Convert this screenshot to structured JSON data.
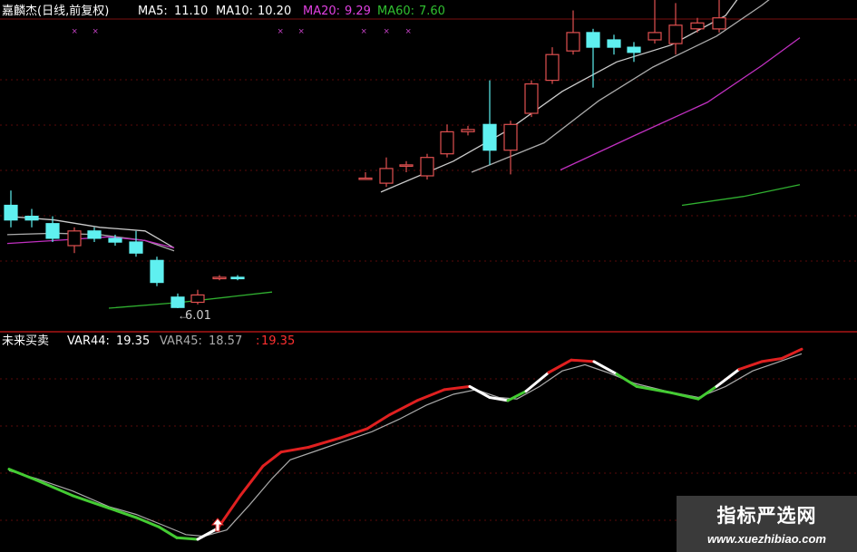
{
  "chart_data": [
    {
      "type": "line",
      "panel": "main",
      "title": "嘉麟杰(日线,前复权)",
      "indicators": [
        {
          "name": "MA5",
          "label": "MA5:",
          "value": "11.10",
          "color": "#ffffff"
        },
        {
          "name": "MA10",
          "label": "MA10:",
          "value": "10.20",
          "color": "#ffffff"
        },
        {
          "name": "MA20",
          "label": "MA20:",
          "value": "9.29",
          "color": "#e040e0"
        },
        {
          "name": "MA60",
          "label": "MA60:",
          "value": "7.60",
          "color": "#30c030"
        }
      ],
      "low_annotation": "6.01",
      "candles": [
        {
          "x": 12,
          "o": 7.4,
          "c": 7.2,
          "h": 7.6,
          "l": 7.1
        },
        {
          "x": 35,
          "o": 7.25,
          "c": 7.2,
          "h": 7.35,
          "l": 7.1
        },
        {
          "x": 58,
          "o": 7.15,
          "c": 6.95,
          "h": 7.25,
          "l": 6.9
        },
        {
          "x": 82,
          "o": 6.85,
          "c": 7.05,
          "h": 7.1,
          "l": 6.75
        },
        {
          "x": 104,
          "o": 7.05,
          "c": 6.95,
          "h": 7.1,
          "l": 6.9
        },
        {
          "x": 127,
          "o": 6.95,
          "c": 6.9,
          "h": 7.0,
          "l": 6.85
        },
        {
          "x": 150,
          "o": 6.9,
          "c": 6.75,
          "h": 7.05,
          "l": 6.7
        },
        {
          "x": 173,
          "o": 6.65,
          "c": 6.35,
          "h": 6.7,
          "l": 6.3
        },
        {
          "x": 196,
          "o": 6.15,
          "c": 6.01,
          "h": 6.2,
          "l": 6.0
        },
        {
          "x": 218,
          "o": 6.08,
          "c": 6.18,
          "h": 6.25,
          "l": 6.05
        },
        {
          "x": 242,
          "o": 6.4,
          "c": 6.42,
          "h": 6.45,
          "l": 6.38
        },
        {
          "x": 262,
          "o": 6.42,
          "c": 6.4,
          "h": 6.45,
          "l": 6.38
        },
        {
          "x": 403,
          "o": 7.77,
          "c": 7.77,
          "h": 7.85,
          "l": 7.75
        },
        {
          "x": 426,
          "o": 7.7,
          "c": 7.9,
          "h": 8.05,
          "l": 7.65
        },
        {
          "x": 448,
          "o": 7.95,
          "c": 7.95,
          "h": 8.0,
          "l": 7.85
        },
        {
          "x": 471,
          "o": 7.8,
          "c": 8.05,
          "h": 8.1,
          "l": 7.75
        },
        {
          "x": 493,
          "o": 8.1,
          "c": 8.4,
          "h": 8.5,
          "l": 8.05
        },
        {
          "x": 516,
          "o": 8.4,
          "c": 8.43,
          "h": 8.48,
          "l": 8.35
        },
        {
          "x": 540,
          "o": 8.5,
          "c": 8.15,
          "h": 9.1,
          "l": 7.95
        },
        {
          "x": 563,
          "o": 8.15,
          "c": 8.5,
          "h": 8.55,
          "l": 7.82
        },
        {
          "x": 586,
          "o": 8.65,
          "c": 9.05,
          "h": 9.1,
          "l": 8.6
        },
        {
          "x": 609,
          "o": 9.1,
          "c": 9.45,
          "h": 9.55,
          "l": 9.05
        },
        {
          "x": 632,
          "o": 9.5,
          "c": 9.75,
          "h": 10.05,
          "l": 9.45
        },
        {
          "x": 654,
          "o": 9.75,
          "c": 9.55,
          "h": 9.8,
          "l": 9.0
        },
        {
          "x": 677,
          "o": 9.65,
          "c": 9.55,
          "h": 9.72,
          "l": 9.45
        },
        {
          "x": 699,
          "o": 9.55,
          "c": 9.48,
          "h": 9.62,
          "l": 9.35
        },
        {
          "x": 722,
          "o": 9.65,
          "c": 9.75,
          "h": 10.25,
          "l": 9.6
        },
        {
          "x": 745,
          "o": 9.6,
          "c": 9.85,
          "h": 10.15,
          "l": 9.45
        },
        {
          "x": 769,
          "o": 9.8,
          "c": 9.88,
          "h": 9.95,
          "l": 9.75
        },
        {
          "x": 793,
          "o": 9.8,
          "c": 9.95,
          "h": 10.72,
          "l": 9.75
        }
      ],
      "ma_lines": [
        {
          "name": "MA5",
          "color": "#cccccc",
          "points": [
            [
              8,
              7.25
            ],
            [
              60,
              7.2
            ],
            [
              110,
              7.1
            ],
            [
              160,
              7.05
            ],
            [
              192,
              6.82
            ],
            [
              420,
              7.58
            ],
            [
              500,
              8.0
            ],
            [
              560,
              8.42
            ],
            [
              620,
              8.95
            ],
            [
              680,
              9.35
            ],
            [
              740,
              9.58
            ],
            [
              800,
              9.98
            ],
            [
              832,
              10.52
            ]
          ]
        },
        {
          "name": "MA10",
          "color": "#aaaaaa",
          "points": [
            [
              8,
              7.0
            ],
            [
              60,
              7.02
            ],
            [
              110,
              7.0
            ],
            [
              160,
              6.92
            ],
            [
              192,
              6.78
            ],
            [
              520,
              7.85
            ],
            [
              600,
              8.25
            ],
            [
              660,
              8.82
            ],
            [
              720,
              9.28
            ],
            [
              790,
              9.7
            ],
            [
              840,
              10.12
            ],
            [
              882,
              10.52
            ]
          ]
        },
        {
          "name": "MA20",
          "color": "#c030c0",
          "points": [
            [
              8,
              6.88
            ],
            [
              60,
              6.92
            ],
            [
              120,
              6.97
            ],
            [
              160,
              6.92
            ],
            [
              192,
              6.82
            ],
            [
              618,
              7.88
            ],
            [
              700,
              8.35
            ],
            [
              780,
              8.8
            ],
            [
              840,
              9.3
            ],
            [
              882,
              9.68
            ]
          ]
        },
        {
          "name": "MA60",
          "color": "#30b030",
          "points": [
            [
              120,
              6.0
            ],
            [
              200,
              6.08
            ],
            [
              300,
              6.22
            ],
            [
              430,
              6.38
            ],
            [
              752,
              7.4
            ],
            [
              820,
              7.52
            ],
            [
              882,
              7.68
            ]
          ]
        }
      ]
    },
    {
      "type": "line",
      "panel": "sub",
      "title": "未来买卖",
      "indicators": [
        {
          "name": "VAR44",
          "label": "VAR44:",
          "value": "19.35",
          "color": "#ffffff"
        },
        {
          "name": "VAR45",
          "label": "VAR45:",
          "value": "18.57",
          "color": "#aaaaaa"
        },
        {
          "name": "VAR46",
          "label": ":",
          "value": "19.35",
          "color": "#ff3030"
        }
      ],
      "series": [
        {
          "name": "VAR44",
          "color": "segments",
          "points": [
            [
              10,
              45
            ],
            [
              40,
              38
            ],
            [
              80,
              28
            ],
            [
              120,
              20
            ],
            [
              150,
              14
            ],
            [
              175,
              8
            ],
            [
              195,
              1
            ],
            [
              218,
              0
            ],
            [
              240,
              7
            ],
            [
              265,
              28
            ],
            [
              290,
              47
            ],
            [
              310,
              56
            ],
            [
              340,
              59
            ],
            [
              375,
              65
            ],
            [
              405,
              71
            ],
            [
              430,
              80
            ],
            [
              460,
              89
            ],
            [
              490,
              96
            ],
            [
              518,
              98
            ],
            [
              540,
              91
            ],
            [
              560,
              89
            ],
            [
              580,
              95
            ],
            [
              605,
              107
            ],
            [
              630,
              115
            ],
            [
              655,
              114
            ],
            [
              680,
              106
            ],
            [
              702,
              98
            ],
            [
              740,
              94
            ],
            [
              770,
              90
            ],
            [
              790,
              98
            ],
            [
              815,
              109
            ],
            [
              840,
              114
            ],
            [
              862,
              116
            ],
            [
              884,
              122
            ]
          ],
          "segment_colors": [
            "green",
            "green",
            "green",
            "green",
            "green",
            "green",
            "green",
            "white",
            "red",
            "red",
            "red",
            "red",
            "red",
            "red",
            "red",
            "red",
            "red",
            "red",
            "white",
            "white",
            "green",
            "white",
            "red",
            "red",
            "white",
            "green",
            "green",
            "green",
            "green",
            "white",
            "red",
            "red",
            "red",
            "red"
          ]
        },
        {
          "name": "VAR45",
          "color": "#aaaaaa",
          "points": [
            [
              10,
              44
            ],
            [
              40,
              39
            ],
            [
              80,
              31
            ],
            [
              120,
              21
            ],
            [
              150,
              16
            ],
            [
              180,
              9
            ],
            [
              205,
              3
            ],
            [
              225,
              2
            ],
            [
              250,
              6
            ],
            [
              275,
              22
            ],
            [
              300,
              39
            ],
            [
              320,
              51
            ],
            [
              350,
              57
            ],
            [
              380,
              63
            ],
            [
              410,
              69
            ],
            [
              440,
              77
            ],
            [
              470,
              86
            ],
            [
              500,
              93
            ],
            [
              525,
              96
            ],
            [
              550,
              91
            ],
            [
              570,
              90
            ],
            [
              595,
              98
            ],
            [
              620,
              108
            ],
            [
              645,
              112
            ],
            [
              670,
              107
            ],
            [
              700,
              100
            ],
            [
              735,
              95
            ],
            [
              770,
              91
            ],
            [
              800,
              98
            ],
            [
              830,
              108
            ],
            [
              855,
              113
            ],
            [
              884,
              119
            ]
          ]
        }
      ],
      "arrow_x": 240
    }
  ],
  "watermark": {
    "title": "指标严选网",
    "url": "www.xuezhibiao.com"
  }
}
